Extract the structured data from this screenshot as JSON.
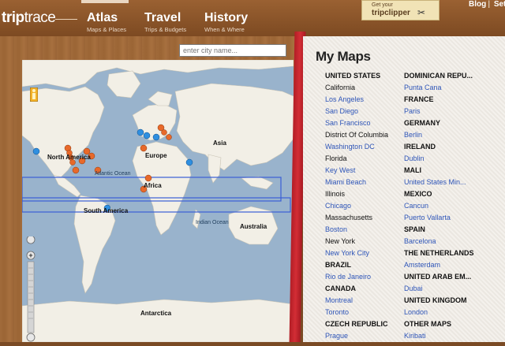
{
  "header": {
    "logo_bold": "trip",
    "logo_thin": "trace",
    "tabs": [
      {
        "title": "Atlas",
        "subtitle": "Maps & Places"
      },
      {
        "title": "Travel",
        "subtitle": "Trips & Budgets"
      },
      {
        "title": "History",
        "subtitle": "When & Where"
      }
    ],
    "clipper": {
      "line1": "Get your",
      "line2": "tripclipper"
    },
    "links": [
      "Blog",
      "Setti"
    ]
  },
  "search": {
    "placeholder": "enter city name..."
  },
  "map": {
    "labels": {
      "north_america": "North America",
      "south_america": "South America",
      "europe": "Europe",
      "africa": "Africa",
      "asia": "Asia",
      "australia": "Australia",
      "antarctica": "Antarctica",
      "atlantic": "Atlantic Ocean",
      "indian": "Indian Ocean"
    }
  },
  "panel": {
    "title": "My Maps",
    "columns": [
      [
        {
          "kind": "head",
          "text": "UNITED STATES"
        },
        {
          "kind": "plain",
          "text": "California"
        },
        {
          "kind": "city",
          "text": "Los Angeles"
        },
        {
          "kind": "city",
          "text": "San Diego"
        },
        {
          "kind": "city",
          "text": "San Francisco"
        },
        {
          "kind": "plain",
          "text": "District Of Columbia"
        },
        {
          "kind": "city",
          "text": "Washington DC"
        },
        {
          "kind": "plain",
          "text": "Florida"
        },
        {
          "kind": "city",
          "text": "Key West"
        },
        {
          "kind": "city",
          "text": "Miami Beach"
        },
        {
          "kind": "plain",
          "text": "Illinois"
        },
        {
          "kind": "city",
          "text": "Chicago"
        },
        {
          "kind": "plain",
          "text": "Massachusetts"
        },
        {
          "kind": "city",
          "text": "Boston"
        },
        {
          "kind": "plain",
          "text": "New York"
        },
        {
          "kind": "city",
          "text": "New York City"
        },
        {
          "kind": "head",
          "text": "BRAZIL"
        },
        {
          "kind": "city",
          "text": "Rio de Janeiro"
        },
        {
          "kind": "head",
          "text": "CANADA"
        },
        {
          "kind": "city",
          "text": "Montreal"
        },
        {
          "kind": "city",
          "text": "Toronto"
        },
        {
          "kind": "head",
          "text": "CZECH REPUBLIC"
        },
        {
          "kind": "city",
          "text": "Prague"
        }
      ],
      [
        {
          "kind": "head",
          "text": "DOMINICAN REPU..."
        },
        {
          "kind": "city",
          "text": "Punta Cana"
        },
        {
          "kind": "head",
          "text": "FRANCE"
        },
        {
          "kind": "city",
          "text": "Paris"
        },
        {
          "kind": "head",
          "text": "GERMANY"
        },
        {
          "kind": "city",
          "text": "Berlin"
        },
        {
          "kind": "head",
          "text": "IRELAND"
        },
        {
          "kind": "city",
          "text": "Dublin"
        },
        {
          "kind": "head",
          "text": "MALI"
        },
        {
          "kind": "city",
          "text": "United States Min..."
        },
        {
          "kind": "head",
          "text": "MEXICO"
        },
        {
          "kind": "city",
          "text": "Cancun"
        },
        {
          "kind": "city",
          "text": "Puerto Vallarta"
        },
        {
          "kind": "head",
          "text": "SPAIN"
        },
        {
          "kind": "city",
          "text": "Barcelona"
        },
        {
          "kind": "head",
          "text": "THE NETHERLANDS"
        },
        {
          "kind": "city",
          "text": "Amsterdam"
        },
        {
          "kind": "head",
          "text": "UNITED ARAB EM..."
        },
        {
          "kind": "city",
          "text": "Dubai"
        },
        {
          "kind": "head",
          "text": "UNITED KINGDOM"
        },
        {
          "kind": "city",
          "text": "London"
        },
        {
          "kind": "head",
          "text": "OTHER MAPS"
        },
        {
          "kind": "city",
          "text": "Kiribati"
        }
      ]
    ]
  },
  "colors": {
    "city_link": "#2e55b8",
    "strip_red": "#c8262e",
    "pin_orange": "#e8692a",
    "pin_blue": "#2f8fe0"
  }
}
